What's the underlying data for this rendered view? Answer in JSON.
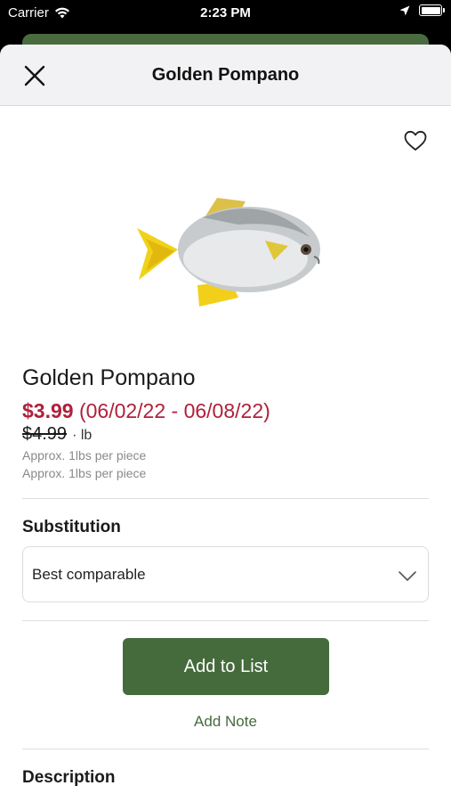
{
  "status_bar": {
    "carrier": "Carrier",
    "time": "2:23 PM"
  },
  "header": {
    "title": "Golden Pompano"
  },
  "product": {
    "name": "Golden Pompano",
    "sale_price": "$3.99",
    "sale_dates": "(06/02/22 - 06/08/22)",
    "regular_price": "$4.99",
    "unit": "· lb",
    "approx_lines": [
      "Approx. 1lbs per piece",
      "Approx. 1lbs per piece"
    ],
    "favorite": false
  },
  "substitution": {
    "label": "Substitution",
    "selected": "Best comparable"
  },
  "actions": {
    "add_to_list": "Add to List",
    "add_note": "Add Note"
  },
  "description": {
    "label": "Description"
  },
  "colors": {
    "brand_green": "#456b3d",
    "sale_red": "#b0203a"
  }
}
